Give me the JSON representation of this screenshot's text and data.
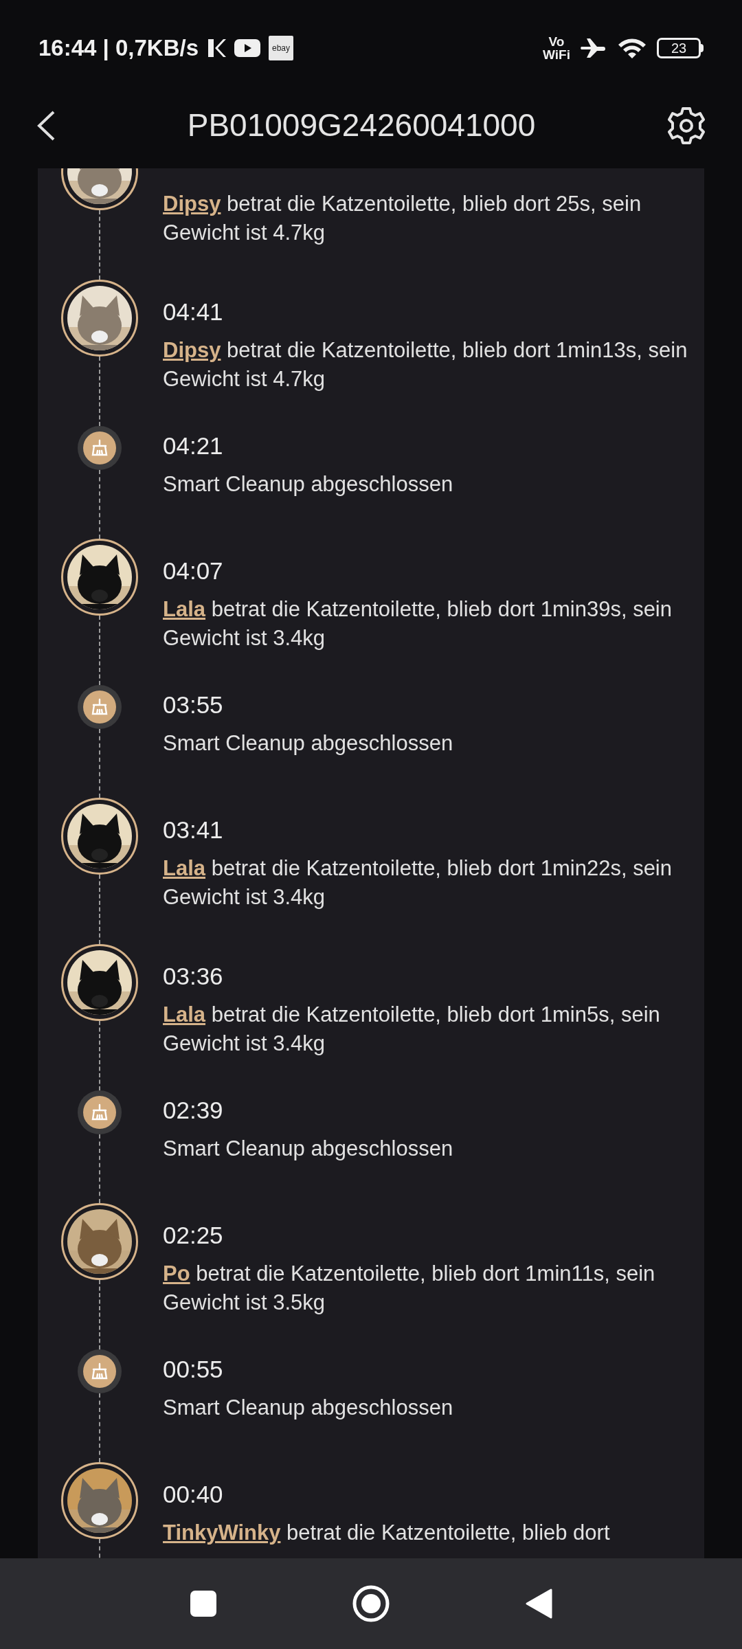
{
  "status_bar": {
    "time_speed": "16:44 | 0,7KB/s",
    "ebay_icon_text": "ebay",
    "vowifi": "Vo",
    "vowifi_sub": "WiFi",
    "battery": "23"
  },
  "header": {
    "title": "PB01009G24260041000"
  },
  "events": [
    {
      "kind": "cat",
      "pet": "Dipsy",
      "text": "betrat die Katzentoilette, blieb dort 25s, sein Gewicht ist 4.7kg"
    },
    {
      "kind": "cat",
      "time": "04:41",
      "pet": "Dipsy",
      "text": "betrat die Katzentoilette, blieb dort 1min13s, sein Gewicht ist 4.7kg"
    },
    {
      "kind": "cleanup",
      "time": "04:21",
      "text": "Smart Cleanup abgeschlossen"
    },
    {
      "kind": "cat",
      "time": "04:07",
      "pet": "Lala",
      "text": "betrat die Katzentoilette, blieb dort 1min39s, sein Gewicht ist 3.4kg"
    },
    {
      "kind": "cleanup",
      "time": "03:55",
      "text": "Smart Cleanup abgeschlossen"
    },
    {
      "kind": "cat",
      "time": "03:41",
      "pet": "Lala",
      "text": "betrat die Katzentoilette, blieb dort 1min22s, sein Gewicht ist 3.4kg"
    },
    {
      "kind": "cat",
      "time": "03:36",
      "pet": "Lala",
      "text": "betrat die Katzentoilette, blieb dort 1min5s, sein Gewicht ist 3.4kg"
    },
    {
      "kind": "cleanup",
      "time": "02:39",
      "text": "Smart Cleanup abgeschlossen"
    },
    {
      "kind": "cat",
      "time": "02:25",
      "pet": "Po",
      "text": "betrat die Katzentoilette, blieb dort 1min11s, sein Gewicht ist 3.5kg"
    },
    {
      "kind": "cleanup",
      "time": "00:55",
      "text": "Smart Cleanup abgeschlossen"
    },
    {
      "kind": "cat",
      "time": "00:40",
      "pet": "TinkyWinky",
      "text": "betrat die Katzentoilette, blieb dort"
    }
  ]
}
